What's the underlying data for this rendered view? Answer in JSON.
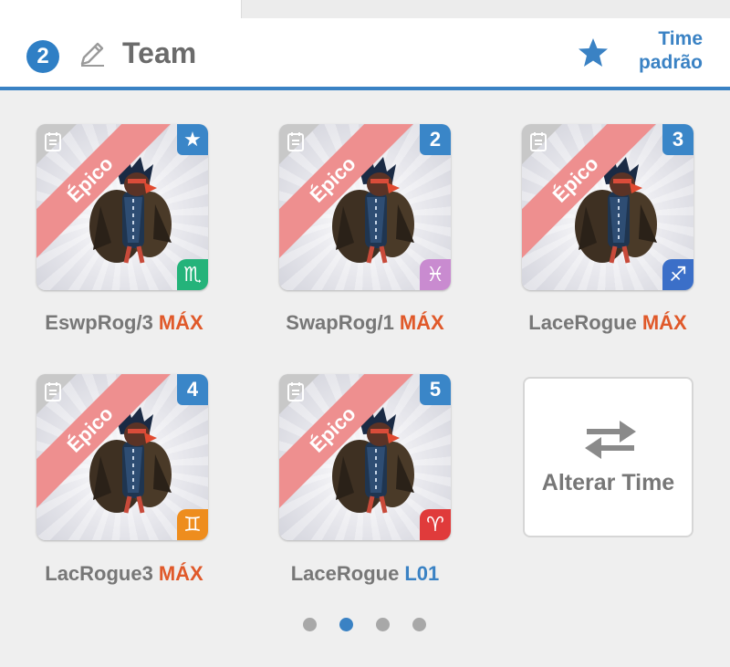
{
  "header": {
    "team_number": "2",
    "team_title": "Team",
    "default_line1": "Time",
    "default_line2": "padrão"
  },
  "colors": {
    "accent": "#3a82c4",
    "max_level": "#e0592a",
    "rarity_ribbon": "#ee8f8f"
  },
  "cards": [
    {
      "name": "EswpRog/3",
      "level": "MÁX",
      "rarity": "Épico",
      "slot": "★",
      "slot_icon": "star-icon",
      "zodiac": "♏",
      "zodiac_name": "scorpio-icon",
      "zodiac_color": "#24b37a"
    },
    {
      "name": "SwapRog/1",
      "level": "MÁX",
      "rarity": "Épico",
      "slot": "2",
      "slot_icon": "",
      "zodiac": "♓",
      "zodiac_name": "pisces-icon",
      "zodiac_color": "#c98bd0"
    },
    {
      "name": "LaceRogue",
      "level": "MÁX",
      "rarity": "Épico",
      "slot": "3",
      "slot_icon": "",
      "zodiac": "♐",
      "zodiac_name": "sagittarius-icon",
      "zodiac_color": "#3b6fc8"
    },
    {
      "name": "LacRogue3",
      "level": "MÁX",
      "rarity": "Épico",
      "slot": "4",
      "slot_icon": "",
      "zodiac": "♊",
      "zodiac_name": "gemini-icon",
      "zodiac_color": "#ee8d1e"
    },
    {
      "name": "LaceRogue",
      "level": "L01",
      "rarity": "Épico",
      "slot": "5",
      "slot_icon": "",
      "zodiac": "♈",
      "zodiac_name": "aries-icon",
      "zodiac_color": "#e03b3b"
    }
  ],
  "change_team": {
    "label": "Alterar Time"
  },
  "pager": {
    "total": 4,
    "active": 1
  }
}
